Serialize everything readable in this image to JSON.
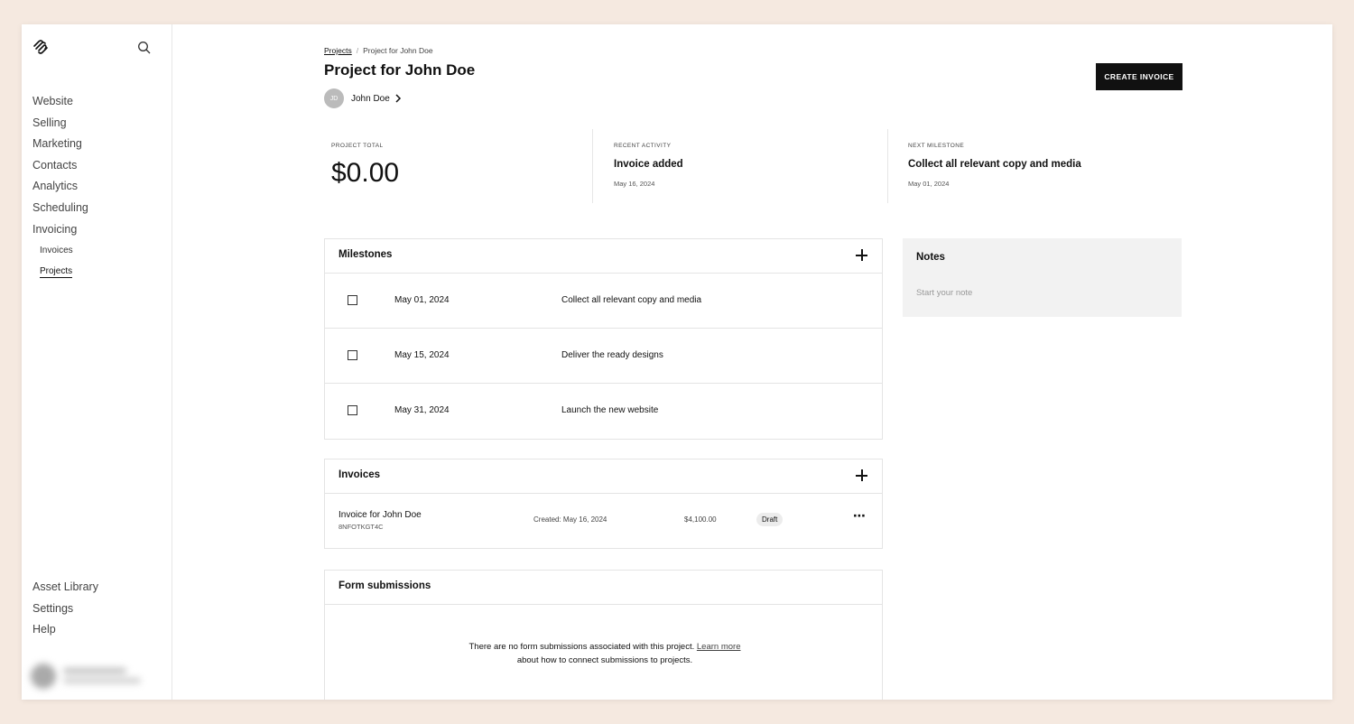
{
  "sidebar": {
    "nav": [
      "Website",
      "Selling",
      "Marketing",
      "Contacts",
      "Analytics",
      "Scheduling",
      "Invoicing"
    ],
    "sub": [
      "Invoices",
      "Projects"
    ],
    "bottom": [
      "Asset Library",
      "Settings",
      "Help"
    ]
  },
  "breadcrumb": {
    "root": "Projects",
    "current": "Project for John Doe"
  },
  "page": {
    "title": "Project for John Doe",
    "create_invoice": "CREATE INVOICE"
  },
  "client": {
    "initials": "JD",
    "name": "John Doe"
  },
  "stats": {
    "total_label": "PROJECT TOTAL",
    "total_value": "$0.00",
    "activity_label": "RECENT ACTIVITY",
    "activity_value": "Invoice added",
    "activity_date": "May 16, 2024",
    "milestone_label": "NEXT MILESTONE",
    "milestone_value": "Collect all relevant copy and media",
    "milestone_date": "May 01, 2024"
  },
  "milestones": {
    "heading": "Milestones",
    "rows": [
      {
        "date": "May 01, 2024",
        "title": "Collect all relevant copy and media"
      },
      {
        "date": "May 15, 2024",
        "title": "Deliver the ready designs"
      },
      {
        "date": "May 31, 2024",
        "title": "Launch the new website"
      }
    ]
  },
  "invoices": {
    "heading": "Invoices",
    "rows": [
      {
        "name": "Invoice for John Doe",
        "id": "8NFOTKGT4C",
        "created": "Created: May 16, 2024",
        "amount": "$4,100.00",
        "status": "Draft"
      }
    ]
  },
  "forms": {
    "heading": "Form submissions",
    "text_before": "There are no form submissions associated with this project.",
    "link": "Learn more",
    "text_after": "about how to connect submissions to projects."
  },
  "notes": {
    "heading": "Notes",
    "placeholder": "Start your note"
  }
}
